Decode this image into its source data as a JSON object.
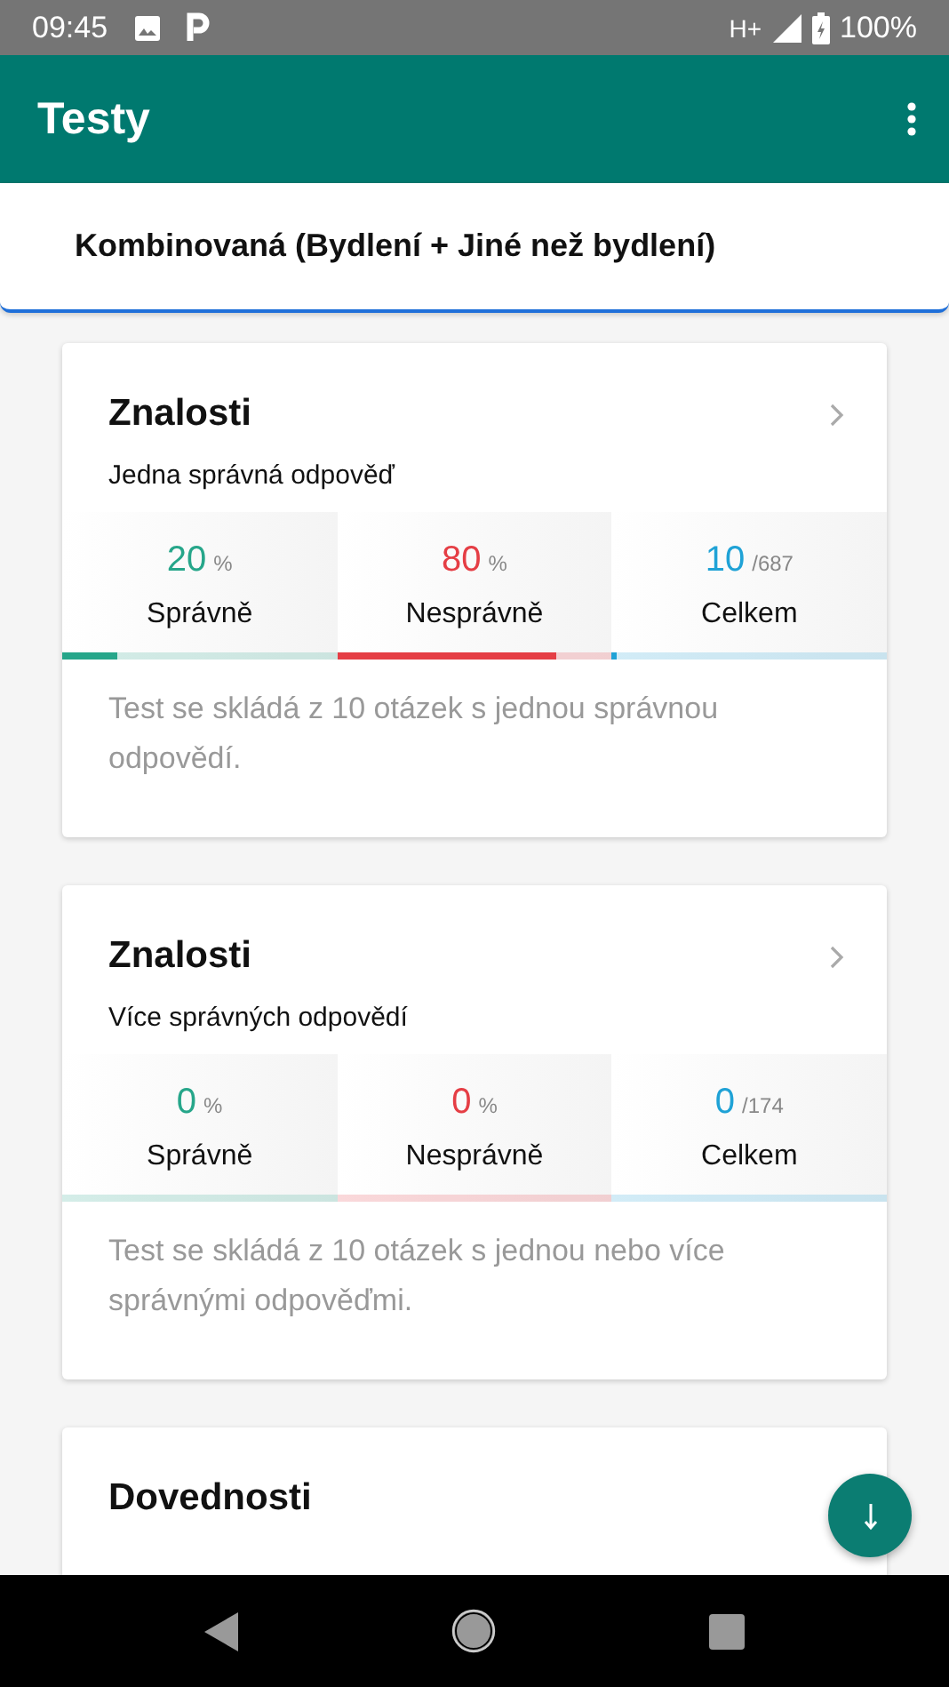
{
  "status_bar": {
    "time": "09:45",
    "network": "H+",
    "battery": "100%"
  },
  "app_bar": {
    "title": "Testy"
  },
  "category": {
    "title": "Kombinovaná (Bydlení + Jiné než bydlení)"
  },
  "cards": [
    {
      "title": "Znalosti",
      "subtitle": "Jedna správná odpověď",
      "description": "Test se skládá z 10 otázek s jednou správnou odpovědí.",
      "stats": [
        {
          "value": "20",
          "unit": "%",
          "label": "Správně",
          "color": "#26a68a",
          "level": 0.2
        },
        {
          "value": "80",
          "unit": "%",
          "label": "Nesprávně",
          "color": "#e53e45",
          "level": 0.8
        },
        {
          "value": "10",
          "unit": "/687",
          "label": "Celkem",
          "color": "#1fa2d6",
          "level": 0.015
        }
      ]
    },
    {
      "title": "Znalosti",
      "subtitle": "Více správných odpovědí",
      "description": "Test se skládá z 10 otázek s jednou nebo více správnými odpověďmi.",
      "stats": [
        {
          "value": "0",
          "unit": "%",
          "label": "Správně",
          "color": "#26a68a",
          "level": 0
        },
        {
          "value": "0",
          "unit": "%",
          "label": "Nesprávně",
          "color": "#e53e45",
          "level": 0
        },
        {
          "value": "0",
          "unit": "/174",
          "label": "Celkem",
          "color": "#1fa2d6",
          "level": 0
        }
      ]
    },
    {
      "title": "Dovednosti"
    }
  ]
}
